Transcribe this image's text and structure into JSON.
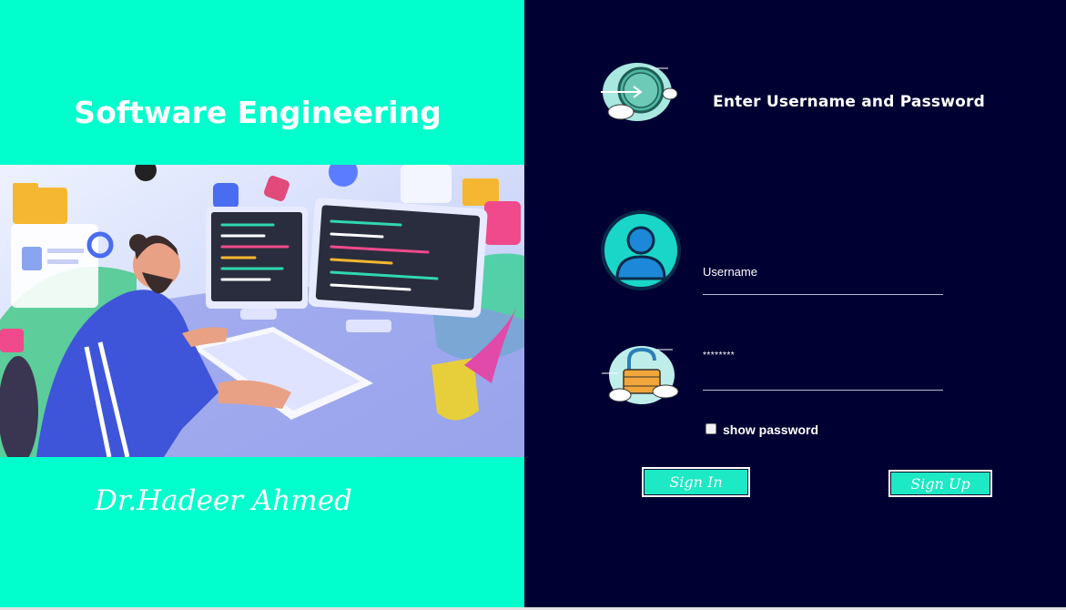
{
  "left": {
    "title": "Software Engineering",
    "author": "Dr.Hadeer Ahmed"
  },
  "login": {
    "heading": "Enter Username and Password",
    "username_label": "Username",
    "password_value": "********",
    "show_password_label": "show password",
    "show_password_checked": false,
    "signin_label": "Sign In",
    "signup_label": "Sign Up"
  },
  "icons": {
    "login": "login-arrow-cloud-icon",
    "user": "user-avatar-icon",
    "lock": "padlock-cloud-icon"
  },
  "colors": {
    "left_bg": "#00ffcc",
    "right_bg": "#000033",
    "button_bg": "#1de9c4"
  }
}
